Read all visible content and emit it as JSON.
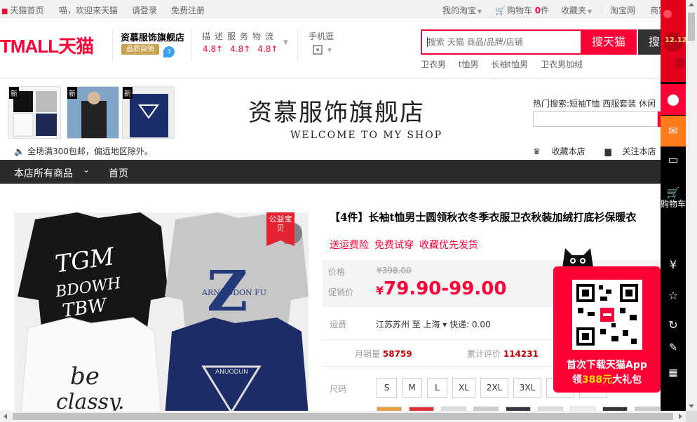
{
  "topnav": {
    "home": "天猫首页",
    "welcome": "喵，欢迎来天猫",
    "login": "请登录",
    "register": "免费注册",
    "my_taobao": "我的淘宝",
    "cart_label": "购物车",
    "cart_count": "0",
    "cart_unit": "件",
    "favorites": "收藏夹",
    "taobao": "淘宝网",
    "merchant": "商家"
  },
  "header": {
    "logo_text": "TMALL天猫",
    "shop_name": "资慕服饰旗舰店",
    "quality_badge": "品质自销",
    "dsr_labels": "描述服务物流",
    "dsr_values": [
      "4.8↑",
      "4.8↑",
      "4.8↑"
    ],
    "mobile_label": "手机逛",
    "search_placeholder": "搜索 天猫 商品/品牌/店铺",
    "search_button": "搜天猫",
    "search_shop_button": "搜本店",
    "hot_words": [
      "卫衣男",
      "t恤男",
      "长袖t恤男",
      "卫衣男加绒"
    ]
  },
  "banner": {
    "thumb_tag": "新",
    "shop_title": "资慕服饰旗舰店",
    "shop_subtitle": "WELCOME TO MY SHOP",
    "hot_search": "热门搜索:短袖T恤  西服套装  休闲",
    "free_shipping": "全场满300包邮，偏远地区除外。",
    "fav_shop": "收藏本店",
    "follow_shop": "关注本店"
  },
  "menubar": {
    "all_products": "本店所有商品",
    "home": "首页"
  },
  "product": {
    "gongyi_tag": "公益宝贝",
    "title": "【4件】长袖t恤男士圆领秋衣冬季衣服卫衣秋装加绒打底衫保暖衣",
    "promos": [
      "送运费险",
      "免费试穿",
      "收藏优先发货"
    ],
    "price_label": "价格",
    "original_price": "¥398.00",
    "promo_price_label": "促销价",
    "promo_price_currency": "¥",
    "promo_price": "79.90-99.00",
    "shipping_label": "运费",
    "shipping_value": "江苏苏州  至 上海 ▾ 快递: 0.00",
    "monthly_sales_label": "月销量",
    "monthly_sales": "58759",
    "reviews_label": "累计评价",
    "reviews": "114231",
    "size_label": "尺码",
    "sizes": [
      "S",
      "M",
      "L",
      "XL",
      "2XL",
      "3XL"
    ]
  },
  "sidebar": {
    "promo_tag": "12.12",
    "cart_text": "购物车"
  },
  "app_popup": {
    "line1": "首次下载天猫App",
    "line2_prefix": "领",
    "line2_amount": "388元",
    "line2_suffix": "大礼包"
  },
  "colors": {
    "brand_red": "#ff0036",
    "dark_bar": "#2b2b2b",
    "sidebar": "#000000"
  }
}
